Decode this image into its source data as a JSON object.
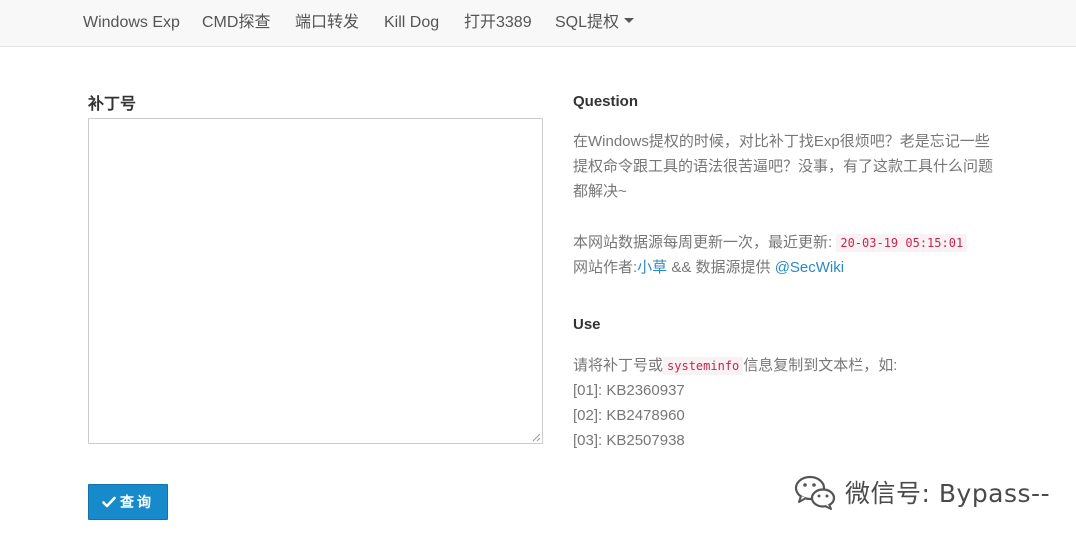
{
  "nav": {
    "items": [
      {
        "label": "Windows Exp"
      },
      {
        "label": "CMD探查"
      },
      {
        "label": "端口转发"
      },
      {
        "label": "Kill Dog"
      },
      {
        "label": "打开3389"
      },
      {
        "label": "SQL提权"
      }
    ]
  },
  "form": {
    "label": "补丁号",
    "textarea_value": "",
    "submit_label": "查询"
  },
  "question": {
    "heading": "Question",
    "lines": [
      "在Windows提权的时候，对比补丁找Exp很烦吧？老是忘记一些",
      "提权命令跟工具的语法很苦逼吧？没事，有了这款工具什么问题",
      "都解决~"
    ],
    "update_prefix": "本网站数据源每周更新一次，最近更新:",
    "update_time": "20-03-19 05:15:01",
    "author_prefix": "网站作者:",
    "author_name": "小草",
    "author_middle": " && 数据源提供 ",
    "source_name": "@SecWiki"
  },
  "use": {
    "heading": "Use",
    "instruction_prefix": "请将补丁号或",
    "instruction_code": "systeminfo",
    "instruction_suffix": "信息复制到文本栏，如:",
    "examples": [
      "[01]: KB2360937",
      "[02]: KB2478960",
      "[03]: KB2507938"
    ]
  },
  "watermark": {
    "text": "微信号: Bypass--",
    "icon": "wechat-icon"
  }
}
